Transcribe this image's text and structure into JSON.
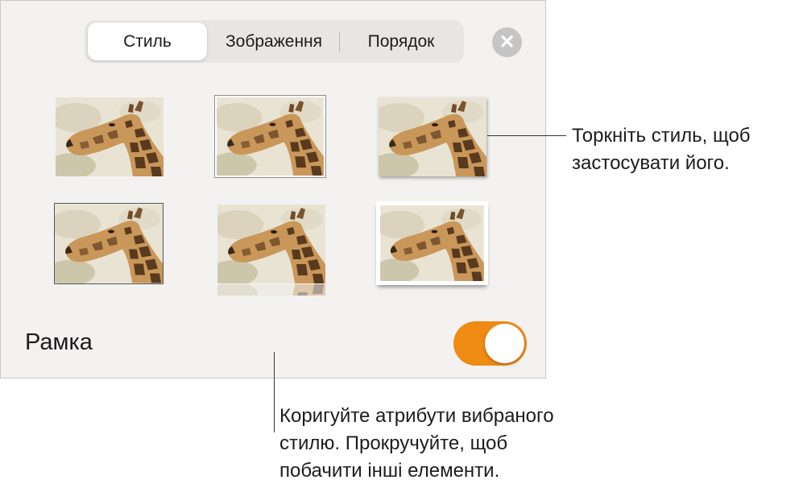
{
  "tabs": [
    {
      "label": "Стиль",
      "active": true
    },
    {
      "label": "Зображення",
      "active": false
    },
    {
      "label": "Порядок",
      "active": false
    }
  ],
  "close_icon": "close-icon",
  "styles": [
    {
      "name": "plain",
      "icon": "giraffe-image"
    },
    {
      "name": "thin-gray-border",
      "icon": "giraffe-image"
    },
    {
      "name": "drop-shadow",
      "icon": "giraffe-image"
    },
    {
      "name": "thin-dark-border",
      "icon": "giraffe-image"
    },
    {
      "name": "reflection",
      "icon": "giraffe-image"
    },
    {
      "name": "white-frame-curled-shadow",
      "icon": "giraffe-image"
    }
  ],
  "frame": {
    "label": "Рамка",
    "on": true
  },
  "colors": {
    "accent": "#ef8a13",
    "panel": "#f3f2f1"
  },
  "callouts": {
    "styles_line1": "Торкніть стиль, щоб",
    "styles_line2": "застосувати його.",
    "adjust_line1": "Коригуйте атрибути вибраного",
    "adjust_line2": "стилю. Прокручуйте, щоб",
    "adjust_line3": "побачити інші елементи."
  }
}
